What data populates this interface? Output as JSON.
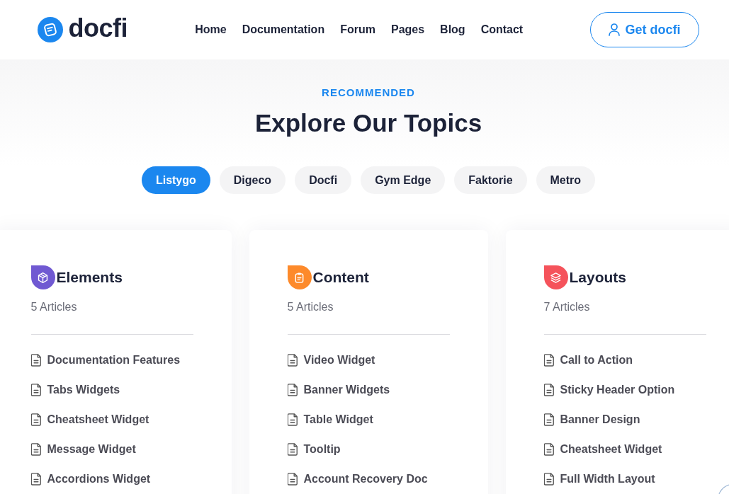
{
  "header": {
    "logo": "docfi",
    "nav": [
      "Home",
      "Documentation",
      "Forum",
      "Pages",
      "Blog",
      "Contact"
    ],
    "cta": "Get docfi"
  },
  "topics": {
    "eyebrow": "RECOMMENDED",
    "title": "Explore Our Topics",
    "filters": [
      {
        "label": "Listygo",
        "selected": true
      },
      {
        "label": "Digeco",
        "selected": false
      },
      {
        "label": "Docfi",
        "selected": false
      },
      {
        "label": "Gym Edge",
        "selected": false
      },
      {
        "label": "Faktorie",
        "selected": false
      },
      {
        "label": "Metro",
        "selected": false
      }
    ]
  },
  "categories": [
    {
      "title": "Elements",
      "color": "#7059d2",
      "count": "5 Articles",
      "articles": [
        "Documentation Features",
        "Tabs Widgets",
        "Cheatsheet Widget",
        "Message Widget",
        "Accordions Widget"
      ]
    },
    {
      "title": "Content",
      "color": "#fd8a2b",
      "count": "5 Articles",
      "articles": [
        "Video Widget",
        "Banner Widgets",
        "Table Widget",
        "Tooltip",
        "Account Recovery Doc"
      ]
    },
    {
      "title": "Layouts",
      "color": "#f5535b",
      "count": "7 Articles",
      "articles": [
        "Call to Action",
        "Sticky Header Option",
        "Banner Design",
        "Cheatsheet Widget",
        "Full Width Layout"
      ]
    }
  ]
}
